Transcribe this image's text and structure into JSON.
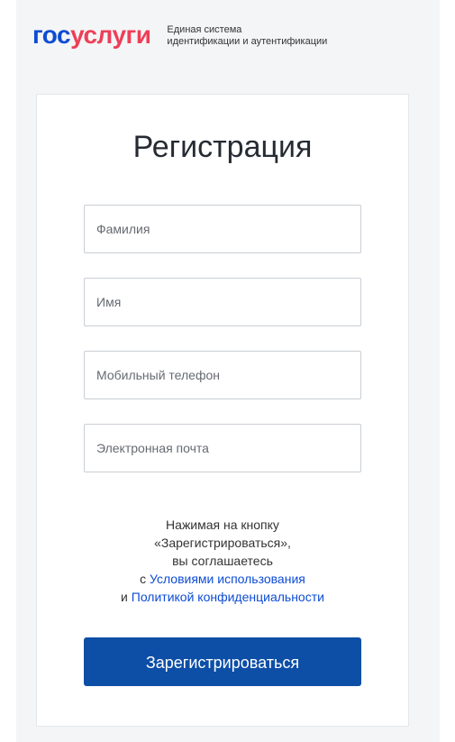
{
  "header": {
    "logo_part1": "гос",
    "logo_part2": "услуги",
    "tagline_line1": "Единая система",
    "tagline_line2": "идентификации и аутентификации"
  },
  "form": {
    "title": "Регистрация",
    "fields": [
      {
        "placeholder": "Фамилия",
        "value": ""
      },
      {
        "placeholder": "Имя",
        "value": ""
      },
      {
        "placeholder": "Мобильный телефон",
        "value": ""
      },
      {
        "placeholder": "Электронная почта",
        "value": ""
      }
    ],
    "notice": {
      "line1": "Нажимая на кнопку",
      "line2": "«Зарегистрироваться»,",
      "line3": "вы соглашаетесь",
      "line4_prefix": "с ",
      "terms_link": "Условиями использования",
      "line5_prefix": "и ",
      "privacy_link": "Политикой конфиденциальности"
    },
    "submit_label": "Зарегистрироваться"
  },
  "colors": {
    "brand_blue": "#0d4cd3",
    "brand_red": "#ee3f58",
    "button_blue": "#0d4ea7"
  }
}
